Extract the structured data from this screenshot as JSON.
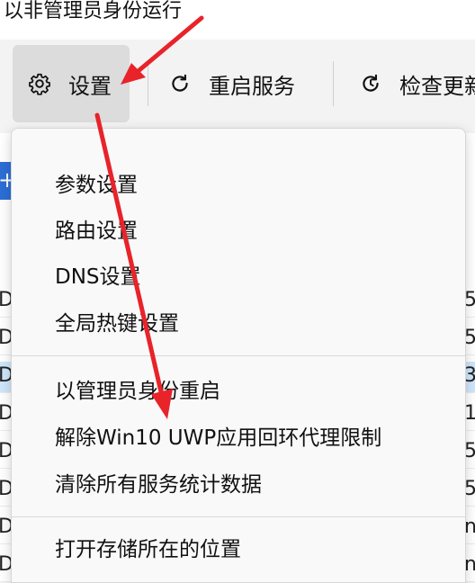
{
  "window": {
    "title": "以非管理员身份运行"
  },
  "toolbar": {
    "buttons": [
      {
        "label": "设置",
        "icon": "gear-icon"
      },
      {
        "label": "重启服务",
        "icon": "restart-icon"
      },
      {
        "label": "检查更新",
        "icon": "check-update-icon"
      }
    ]
  },
  "background_list": {
    "left_glyph": "D",
    "rows_right": [
      "5",
      "5",
      "3",
      "1",
      "5",
      "5",
      "n",
      "n"
    ]
  },
  "background_chip": {
    "label": "+"
  },
  "menu": {
    "groups": [
      {
        "items": [
          "参数设置",
          "路由设置",
          "DNS设置",
          "全局热键设置"
        ]
      },
      {
        "items": [
          "以管理员身份重启",
          "解除Win10 UWP应用回环代理限制",
          "清除所有服务统计数据"
        ]
      },
      {
        "items": [
          "打开存储所在的位置"
        ]
      }
    ]
  },
  "colors": {
    "accent": "#2b6fd6",
    "annotation_red": "#e8232a",
    "selected_row": "#cfe6fb"
  }
}
